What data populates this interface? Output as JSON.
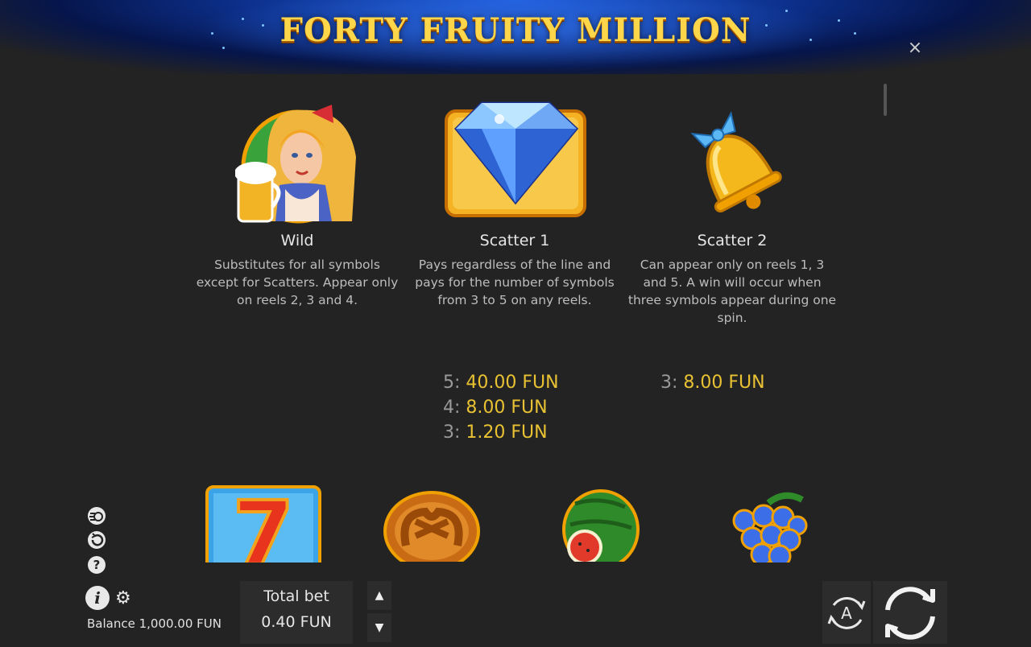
{
  "header": {
    "title": "FORTY FRUITY MILLION",
    "close_label": "×"
  },
  "symbols": [
    {
      "name": "Wild",
      "icon": "wild-girl-icon",
      "description": "Substitutes for all symbols except for Scatters. Appear only on reels 2, 3 and 4."
    },
    {
      "name": "Scatter 1",
      "icon": "diamond-icon",
      "description": "Pays regardless of the line and pays for the number of symbols from 3 to 5 on any reels."
    },
    {
      "name": "Scatter 2",
      "icon": "bell-icon",
      "description": "Can appear only on reels 1, 3 and 5. A win will occur when three symbols appear during one spin."
    }
  ],
  "scatter1_pays": [
    {
      "count": "5:",
      "value": "40.00 FUN"
    },
    {
      "count": "4:",
      "value": "8.00 FUN"
    },
    {
      "count": "3:",
      "value": "1.20 FUN"
    }
  ],
  "scatter2_pays": [
    {
      "count": "3:",
      "value": "8.00 FUN"
    }
  ],
  "lower_symbols": [
    "seven-icon",
    "pretzel-icon",
    "watermelon-icon",
    "grapes-icon"
  ],
  "seven_label": "7",
  "side_icons": [
    "turbo-icon",
    "history-icon",
    "help-icon"
  ],
  "help_label": "?",
  "info_label": "i",
  "settings_label": "⚙",
  "footer": {
    "balance": "Balance 1,000.00 FUN",
    "total_bet_label": "Total bet",
    "total_bet_value": "0.40 FUN",
    "bet_up": "▲",
    "bet_down": "▼",
    "auto_label": "A"
  },
  "colors": {
    "accent_gold": "#e9c233",
    "background": "#232323",
    "header_blue": "#0c2f8a"
  }
}
